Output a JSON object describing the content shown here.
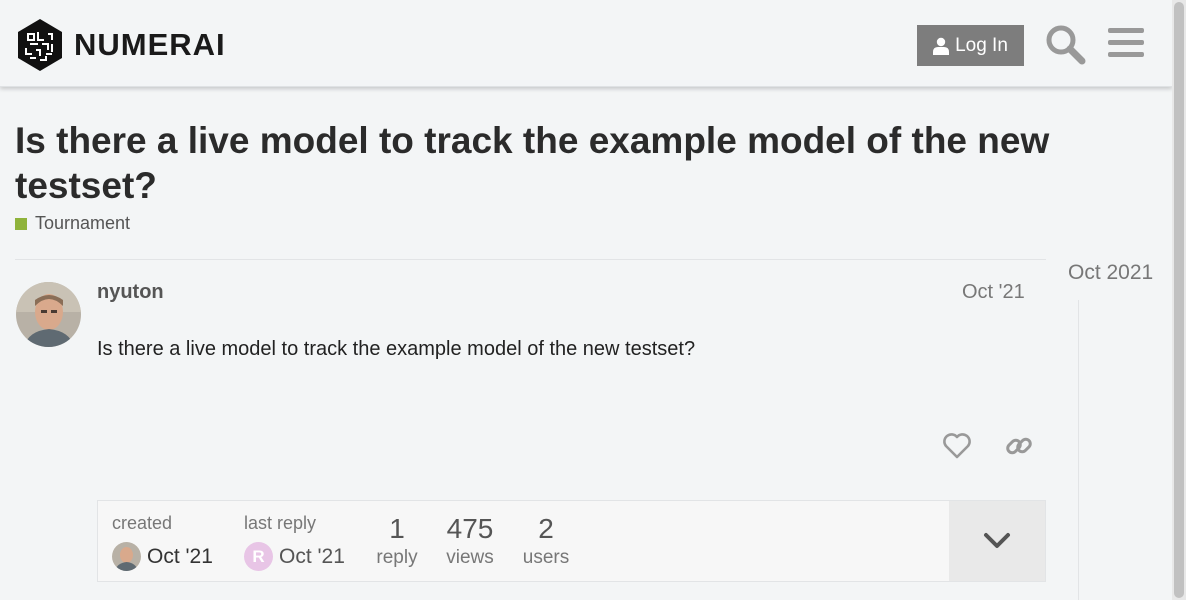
{
  "header": {
    "brand": "NUMERAI",
    "login_label": "Log In",
    "icons": [
      "user-icon",
      "search-icon",
      "hamburger-menu-icon"
    ]
  },
  "topic": {
    "title": "Is there a live model to track the example model of the new testset?",
    "category": {
      "label": "Tournament",
      "color": "#8fb33b"
    }
  },
  "post": {
    "username": "nyuton",
    "date": "Oct '21",
    "body": "Is there a live model to track the example model of the new testset?",
    "actions": [
      "heart-icon",
      "link-icon"
    ]
  },
  "meta": {
    "created_label": "created",
    "created_date": "Oct '21",
    "last_reply_label": "last reply",
    "last_reply_date": "Oct '21",
    "last_reply_avatar_letter": "R",
    "replies_count": "1",
    "replies_label": "reply",
    "views_count": "475",
    "views_label": "views",
    "users_count": "2",
    "users_label": "users"
  },
  "timeline": {
    "date": "Oct 2021"
  },
  "colors": {
    "login_button": "#7d7d7d",
    "category": "#8fb33b",
    "reply_avatar": "#e8c5e6"
  }
}
